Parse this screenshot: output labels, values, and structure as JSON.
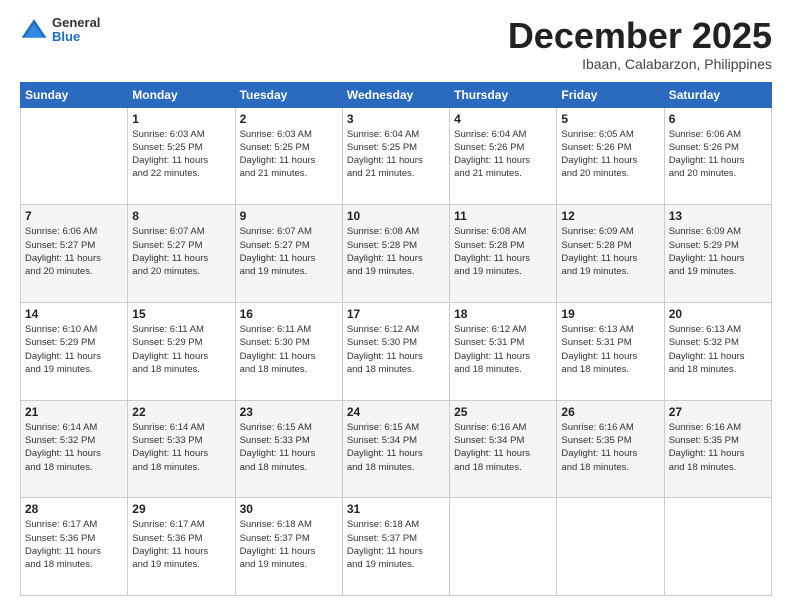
{
  "header": {
    "logo": {
      "general": "General",
      "blue": "Blue"
    },
    "title": "December 2025",
    "location": "Ibaan, Calabarzon, Philippines"
  },
  "calendar": {
    "weekdays": [
      "Sunday",
      "Monday",
      "Tuesday",
      "Wednesday",
      "Thursday",
      "Friday",
      "Saturday"
    ],
    "weeks": [
      [
        {
          "day": "",
          "sunrise": "",
          "sunset": "",
          "daylight": ""
        },
        {
          "day": "1",
          "sunrise": "Sunrise: 6:03 AM",
          "sunset": "Sunset: 5:25 PM",
          "daylight": "Daylight: 11 hours and 22 minutes."
        },
        {
          "day": "2",
          "sunrise": "Sunrise: 6:03 AM",
          "sunset": "Sunset: 5:25 PM",
          "daylight": "Daylight: 11 hours and 21 minutes."
        },
        {
          "day": "3",
          "sunrise": "Sunrise: 6:04 AM",
          "sunset": "Sunset: 5:25 PM",
          "daylight": "Daylight: 11 hours and 21 minutes."
        },
        {
          "day": "4",
          "sunrise": "Sunrise: 6:04 AM",
          "sunset": "Sunset: 5:26 PM",
          "daylight": "Daylight: 11 hours and 21 minutes."
        },
        {
          "day": "5",
          "sunrise": "Sunrise: 6:05 AM",
          "sunset": "Sunset: 5:26 PM",
          "daylight": "Daylight: 11 hours and 20 minutes."
        },
        {
          "day": "6",
          "sunrise": "Sunrise: 6:06 AM",
          "sunset": "Sunset: 5:26 PM",
          "daylight": "Daylight: 11 hours and 20 minutes."
        }
      ],
      [
        {
          "day": "7",
          "sunrise": "Sunrise: 6:06 AM",
          "sunset": "Sunset: 5:27 PM",
          "daylight": "Daylight: 11 hours and 20 minutes."
        },
        {
          "day": "8",
          "sunrise": "Sunrise: 6:07 AM",
          "sunset": "Sunset: 5:27 PM",
          "daylight": "Daylight: 11 hours and 20 minutes."
        },
        {
          "day": "9",
          "sunrise": "Sunrise: 6:07 AM",
          "sunset": "Sunset: 5:27 PM",
          "daylight": "Daylight: 11 hours and 19 minutes."
        },
        {
          "day": "10",
          "sunrise": "Sunrise: 6:08 AM",
          "sunset": "Sunset: 5:28 PM",
          "daylight": "Daylight: 11 hours and 19 minutes."
        },
        {
          "day": "11",
          "sunrise": "Sunrise: 6:08 AM",
          "sunset": "Sunset: 5:28 PM",
          "daylight": "Daylight: 11 hours and 19 minutes."
        },
        {
          "day": "12",
          "sunrise": "Sunrise: 6:09 AM",
          "sunset": "Sunset: 5:28 PM",
          "daylight": "Daylight: 11 hours and 19 minutes."
        },
        {
          "day": "13",
          "sunrise": "Sunrise: 6:09 AM",
          "sunset": "Sunset: 5:29 PM",
          "daylight": "Daylight: 11 hours and 19 minutes."
        }
      ],
      [
        {
          "day": "14",
          "sunrise": "Sunrise: 6:10 AM",
          "sunset": "Sunset: 5:29 PM",
          "daylight": "Daylight: 11 hours and 19 minutes."
        },
        {
          "day": "15",
          "sunrise": "Sunrise: 6:11 AM",
          "sunset": "Sunset: 5:29 PM",
          "daylight": "Daylight: 11 hours and 18 minutes."
        },
        {
          "day": "16",
          "sunrise": "Sunrise: 6:11 AM",
          "sunset": "Sunset: 5:30 PM",
          "daylight": "Daylight: 11 hours and 18 minutes."
        },
        {
          "day": "17",
          "sunrise": "Sunrise: 6:12 AM",
          "sunset": "Sunset: 5:30 PM",
          "daylight": "Daylight: 11 hours and 18 minutes."
        },
        {
          "day": "18",
          "sunrise": "Sunrise: 6:12 AM",
          "sunset": "Sunset: 5:31 PM",
          "daylight": "Daylight: 11 hours and 18 minutes."
        },
        {
          "day": "19",
          "sunrise": "Sunrise: 6:13 AM",
          "sunset": "Sunset: 5:31 PM",
          "daylight": "Daylight: 11 hours and 18 minutes."
        },
        {
          "day": "20",
          "sunrise": "Sunrise: 6:13 AM",
          "sunset": "Sunset: 5:32 PM",
          "daylight": "Daylight: 11 hours and 18 minutes."
        }
      ],
      [
        {
          "day": "21",
          "sunrise": "Sunrise: 6:14 AM",
          "sunset": "Sunset: 5:32 PM",
          "daylight": "Daylight: 11 hours and 18 minutes."
        },
        {
          "day": "22",
          "sunrise": "Sunrise: 6:14 AM",
          "sunset": "Sunset: 5:33 PM",
          "daylight": "Daylight: 11 hours and 18 minutes."
        },
        {
          "day": "23",
          "sunrise": "Sunrise: 6:15 AM",
          "sunset": "Sunset: 5:33 PM",
          "daylight": "Daylight: 11 hours and 18 minutes."
        },
        {
          "day": "24",
          "sunrise": "Sunrise: 6:15 AM",
          "sunset": "Sunset: 5:34 PM",
          "daylight": "Daylight: 11 hours and 18 minutes."
        },
        {
          "day": "25",
          "sunrise": "Sunrise: 6:16 AM",
          "sunset": "Sunset: 5:34 PM",
          "daylight": "Daylight: 11 hours and 18 minutes."
        },
        {
          "day": "26",
          "sunrise": "Sunrise: 6:16 AM",
          "sunset": "Sunset: 5:35 PM",
          "daylight": "Daylight: 11 hours and 18 minutes."
        },
        {
          "day": "27",
          "sunrise": "Sunrise: 6:16 AM",
          "sunset": "Sunset: 5:35 PM",
          "daylight": "Daylight: 11 hours and 18 minutes."
        }
      ],
      [
        {
          "day": "28",
          "sunrise": "Sunrise: 6:17 AM",
          "sunset": "Sunset: 5:36 PM",
          "daylight": "Daylight: 11 hours and 18 minutes."
        },
        {
          "day": "29",
          "sunrise": "Sunrise: 6:17 AM",
          "sunset": "Sunset: 5:36 PM",
          "daylight": "Daylight: 11 hours and 19 minutes."
        },
        {
          "day": "30",
          "sunrise": "Sunrise: 6:18 AM",
          "sunset": "Sunset: 5:37 PM",
          "daylight": "Daylight: 11 hours and 19 minutes."
        },
        {
          "day": "31",
          "sunrise": "Sunrise: 6:18 AM",
          "sunset": "Sunset: 5:37 PM",
          "daylight": "Daylight: 11 hours and 19 minutes."
        },
        {
          "day": "",
          "sunrise": "",
          "sunset": "",
          "daylight": ""
        },
        {
          "day": "",
          "sunrise": "",
          "sunset": "",
          "daylight": ""
        },
        {
          "day": "",
          "sunrise": "",
          "sunset": "",
          "daylight": ""
        }
      ]
    ]
  }
}
